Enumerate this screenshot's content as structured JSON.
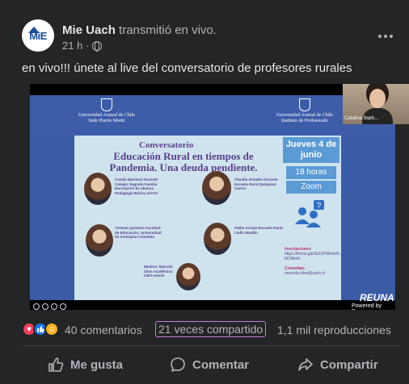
{
  "post": {
    "author": "Mie Uach",
    "action_text": "transmitió en vivo.",
    "time": "21 h ·",
    "avatar_logo": "MiE",
    "text": "en vivo!!! únete al live del conversatorio de profesores rurales",
    "more_icon": "more-horizontal-icon",
    "privacy_icon": "globe-icon"
  },
  "video": {
    "speaker_name": "Catalina Ibarb...",
    "university_left": [
      "Universidad Austral de Chile",
      "Sede Puerto Montt"
    ],
    "university_right": [
      "Universidad Austral de Chile",
      "Instituto de Profesorado"
    ],
    "poster": {
      "title1": "Conversatorio",
      "title2": "Educación Rural en tiempos de Pandemia. Una deuda pendiente.",
      "date": "Jueves 4 de junio",
      "hours": "18 horas",
      "platform": "Zoom",
      "speaker1": "Camila Martínez Docente Colegio Sagrada Familia Hornopirén Ex alumna Pedagogía Básica UACH",
      "speaker2": "Claudia Ormeño Docente Escuela Rural Quilquico Castro",
      "speaker3": "Yesenia Quintero Facultad de Educación, Universidad de Antioquia Colombia",
      "speaker4": "Pablo Arriaza Escuela Rural Llollo Maullín",
      "moderator": "Modera: Marcela Silva Académica CIEA-UACH",
      "inscriptions_label": "Inscripciones:",
      "inscriptions_link": "https://forms.gle/SiZZFWmieKtbCWbx6",
      "consultas_label": "Consultas:",
      "consultas_email": "marcela.silva@uach.cl"
    },
    "brand": "REUNA",
    "powered": "Powered by Zoom"
  },
  "stats": {
    "reactions": [
      "heart-icon",
      "thumbs-up-icon",
      "care-icon"
    ],
    "comments": "40 comentarios",
    "shares": "21 veces compartido",
    "views": "1,1 mil reproducciones"
  },
  "actions": {
    "like": "Me gusta",
    "comment": "Comentar",
    "share": "Compartir"
  },
  "colors": {
    "background": "#242526",
    "text_primary": "#e4e6eb",
    "text_secondary": "#b0b3b8",
    "share_highlight": "#c77ddf"
  }
}
